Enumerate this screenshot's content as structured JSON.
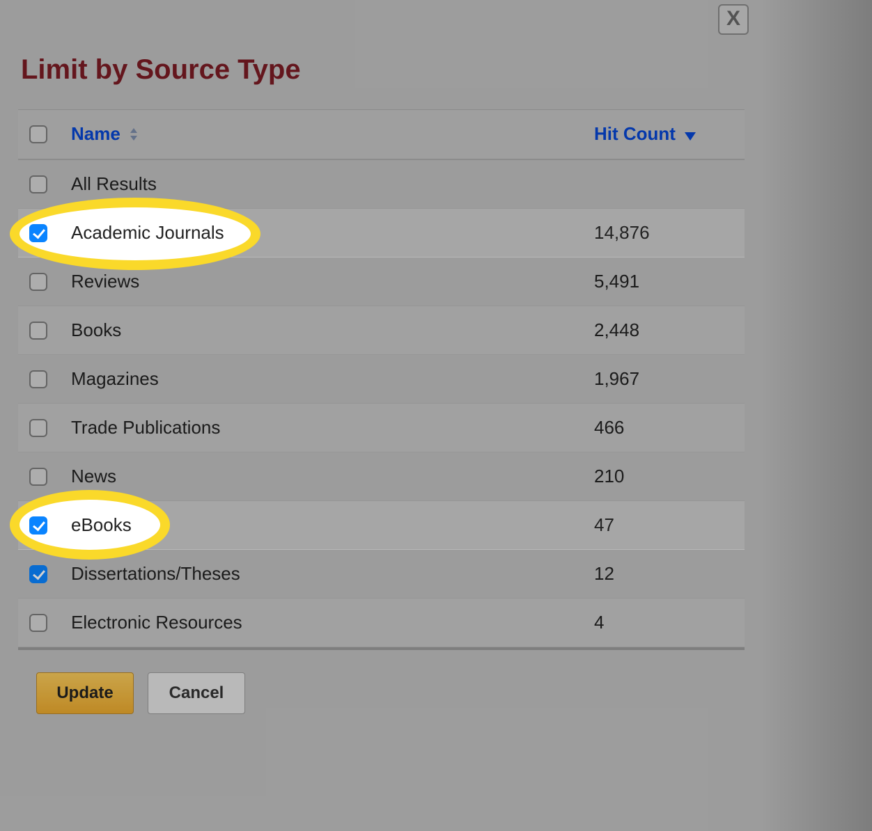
{
  "modal": {
    "title": "Limit by Source Type",
    "close_label": "X",
    "columns": {
      "name": "Name",
      "hit_count": "Hit Count"
    },
    "rows": [
      {
        "name": "All Results",
        "count": "",
        "checked": false,
        "highlight": false
      },
      {
        "name": "Academic Journals",
        "count": "14,876",
        "checked": true,
        "highlight": true
      },
      {
        "name": "Reviews",
        "count": "5,491",
        "checked": false,
        "highlight": false
      },
      {
        "name": "Books",
        "count": "2,448",
        "checked": false,
        "highlight": false
      },
      {
        "name": "Magazines",
        "count": "1,967",
        "checked": false,
        "highlight": false
      },
      {
        "name": "Trade Publications",
        "count": "466",
        "checked": false,
        "highlight": false
      },
      {
        "name": "News",
        "count": "210",
        "checked": false,
        "highlight": false
      },
      {
        "name": "eBooks",
        "count": "47",
        "checked": true,
        "highlight": true
      },
      {
        "name": "Dissertations/Theses",
        "count": "12",
        "checked": true,
        "highlight": false
      },
      {
        "name": "Electronic Resources",
        "count": "4",
        "checked": false,
        "highlight": false
      }
    ],
    "buttons": {
      "update": "Update",
      "cancel": "Cancel"
    }
  }
}
